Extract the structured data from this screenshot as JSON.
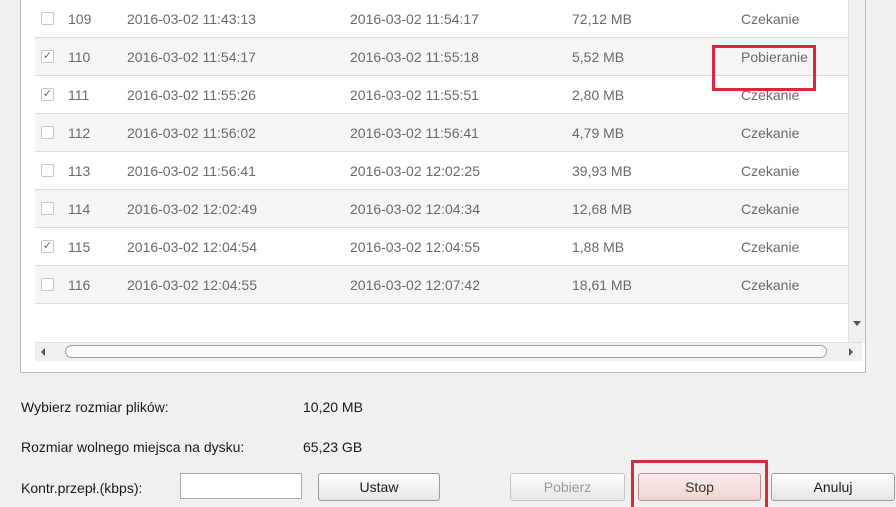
{
  "rows": [
    {
      "id": "109",
      "start": "2016-03-02 11:43:13",
      "end": "2016-03-02 11:54:17",
      "size": "72,12 MB",
      "status": "Czekanie",
      "checked": false
    },
    {
      "id": "110",
      "start": "2016-03-02 11:54:17",
      "end": "2016-03-02 11:55:18",
      "size": "5,52 MB",
      "status": "Pobieranie",
      "checked": true
    },
    {
      "id": "111",
      "start": "2016-03-02 11:55:26",
      "end": "2016-03-02 11:55:51",
      "size": "2,80 MB",
      "status": "Czekanie",
      "checked": true
    },
    {
      "id": "112",
      "start": "2016-03-02 11:56:02",
      "end": "2016-03-02 11:56:41",
      "size": "4,79 MB",
      "status": "Czekanie",
      "checked": false
    },
    {
      "id": "113",
      "start": "2016-03-02 11:56:41",
      "end": "2016-03-02 12:02:25",
      "size": "39,93 MB",
      "status": "Czekanie",
      "checked": false
    },
    {
      "id": "114",
      "start": "2016-03-02 12:02:49",
      "end": "2016-03-02 12:04:34",
      "size": "12,68 MB",
      "status": "Czekanie",
      "checked": false
    },
    {
      "id": "115",
      "start": "2016-03-02 12:04:54",
      "end": "2016-03-02 12:04:55",
      "size": "1,88 MB",
      "status": "Czekanie",
      "checked": true
    },
    {
      "id": "116",
      "start": "2016-03-02 12:04:55",
      "end": "2016-03-02 12:07:42",
      "size": "18,61 MB",
      "status": "Czekanie",
      "checked": false
    }
  ],
  "info": {
    "selected_size_label": "Wybierz rozmiar plików:",
    "selected_size_value": "10,20 MB",
    "free_space_label": "Rozmiar wolnego miejsca na dysku:",
    "free_space_value": "65,23 GB",
    "bandwidth_label": "Kontr.przepł.(kbps):",
    "bandwidth_value": ""
  },
  "buttons": {
    "set": "Ustaw",
    "download": "Pobierz",
    "stop": "Stop",
    "cancel": "Anuluj"
  },
  "colors": {
    "highlight": "#d8283a"
  }
}
